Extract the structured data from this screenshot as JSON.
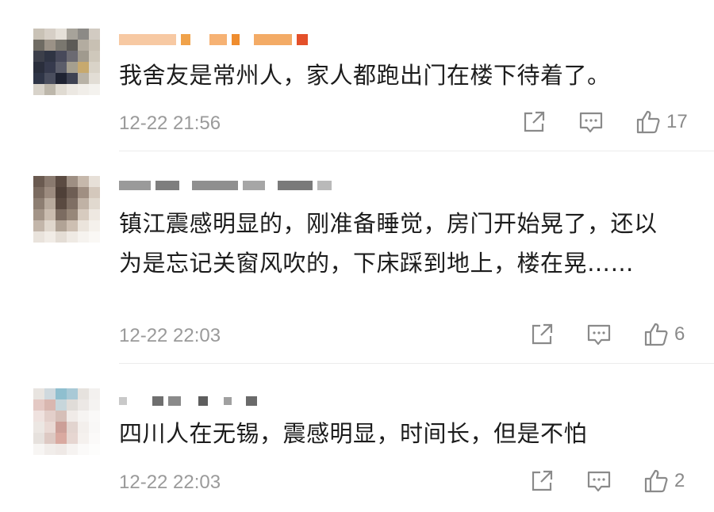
{
  "comments": [
    {
      "text": "我舍友是常州人，家人都跑出门在楼下待着了。",
      "time": "12-22 21:56",
      "likes": "17",
      "avatar_colors": [
        "#c9c2b6",
        "#d6cfc6",
        "#e5e0d8",
        "#a7a39a",
        "#8c8a86",
        "#d2cbc2",
        "#6f6b63",
        "#9b9287",
        "#7a776f",
        "#5c5a56",
        "#b3aca0",
        "#c8c0b3",
        "#3c3f4a",
        "#2f3443",
        "#47495a",
        "#6b6a72",
        "#a09a8e",
        "#cfc8bb",
        "#2a2e3c",
        "#363a4d",
        "#5b5d6a",
        "#a59f8f",
        "#c7a96e",
        "#d9d3c8",
        "#2f3547",
        "#4a4e5e",
        "#1f2332",
        "#3e4252",
        "#b8b2a6",
        "#e2ddd5",
        "#d8d3ca",
        "#bdb7ab",
        "#e0dbd2",
        "#ece8e2",
        "#f1eee9",
        "#f4f2ee"
      ]
    },
    {
      "text": "镇江震感明显的，刚准备睡觉，房门开始晃了，还以为是忘记关窗风吹的，下床踩到地上，楼在晃……",
      "time": "12-22 22:03",
      "likes": "6",
      "avatar_colors": [
        "#6a5a50",
        "#8a7a6f",
        "#5b4b42",
        "#9e8f83",
        "#c6b8ab",
        "#e7e0d8",
        "#7b6b60",
        "#9c8b7f",
        "#4f4038",
        "#6e5e54",
        "#a08f82",
        "#d4c8bc",
        "#8d7e72",
        "#b8aa9d",
        "#5a4a41",
        "#7f6f64",
        "#c0b2a5",
        "#e1d9cf",
        "#a39487",
        "#cabcaf",
        "#7c6c61",
        "#978779",
        "#d7cbbf",
        "#eee8e1",
        "#c3b6aa",
        "#e0d7cd",
        "#b1a396",
        "#cdbfb2",
        "#ebe4dc",
        "#f5f1ec",
        "#e9e3dc",
        "#f1ece6",
        "#e4ddd5",
        "#efeae4",
        "#f6f3ef",
        "#faf8f5"
      ]
    },
    {
      "text": "四川人在无锡，震感明显，时间长，但是不怕",
      "time": "12-22 22:03",
      "likes": "2",
      "avatar_colors": [
        "#e8e4e0",
        "#cfd9de",
        "#8fbfcf",
        "#a9c9d6",
        "#e6e2de",
        "#f3f1ef",
        "#e4c9c4",
        "#d9b7b0",
        "#c7d6db",
        "#e0dcd8",
        "#ece8e5",
        "#f5f3f1",
        "#efe2df",
        "#e3cfca",
        "#d6bfb8",
        "#f0ebe8",
        "#f6f4f2",
        "#faf9f8",
        "#ece7e3",
        "#e9d9d4",
        "#cc9f98",
        "#e2d4cf",
        "#f3efec",
        "#f9f8f7",
        "#e6e1dd",
        "#ddc9c3",
        "#d9a9a0",
        "#e6d6d1",
        "#f5f1ee",
        "#fbfaf9",
        "#f7f5f3",
        "#f1edea",
        "#efe9e6",
        "#f6f3f1",
        "#fbfaf9",
        "#fdfdfc"
      ]
    }
  ]
}
